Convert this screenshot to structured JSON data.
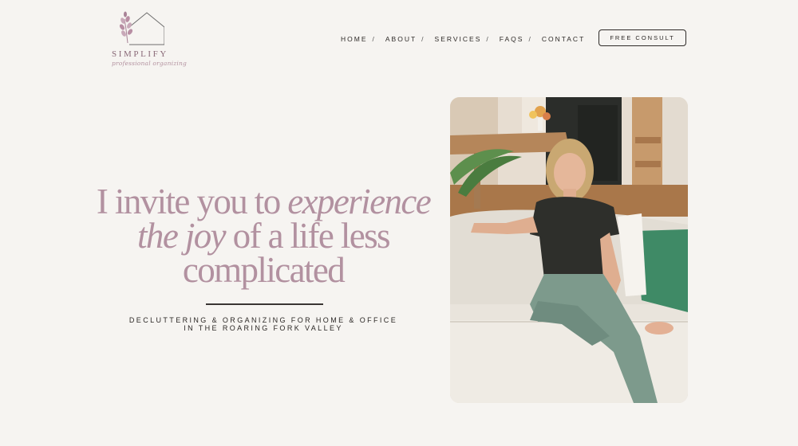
{
  "logo": {
    "brand": "SIMPLIFY",
    "tagline": "professional organizing"
  },
  "nav": {
    "items": [
      {
        "label": "HOME",
        "sep": "/"
      },
      {
        "label": "ABOUT",
        "sep": "/"
      },
      {
        "label": "SERVICES",
        "sep": "/"
      },
      {
        "label": "FAQS",
        "sep": "/"
      },
      {
        "label": "CONTACT",
        "sep": ""
      }
    ],
    "cta": "FREE CONSULT"
  },
  "hero": {
    "line1_a": "I invite you to ",
    "line1_b": "experience",
    "line2_a": "the joy",
    "line2_b": " of a life less",
    "line3": "complicated",
    "subtitle_1": "DECLUTTERING & ORGANIZING FOR HOME & OFFICE",
    "subtitle_2": "IN THE ROARING FORK VALLEY"
  },
  "colors": {
    "background": "#f6f4f1",
    "accent": "#b291a0",
    "text": "#2e2a28"
  },
  "icons": {
    "logo_mark": "house-with-sprig-icon"
  }
}
